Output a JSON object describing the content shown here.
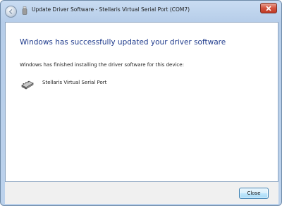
{
  "window": {
    "title": "Update Driver Software - Stellaris Virtual Serial Port (COM7)"
  },
  "icons": {
    "back": "back-arrow-icon",
    "title": "usb-device-icon",
    "close": "close-icon",
    "device": "serial-port-icon"
  },
  "main": {
    "heading": "Windows has successfully updated your driver software",
    "description": "Windows has finished installing the driver software for this device:",
    "device_name": "Stellaris Virtual Serial Port"
  },
  "footer": {
    "close_label": "Close"
  },
  "colors": {
    "heading": "#1e3a8c",
    "titlebar_close": "#c03a25"
  }
}
